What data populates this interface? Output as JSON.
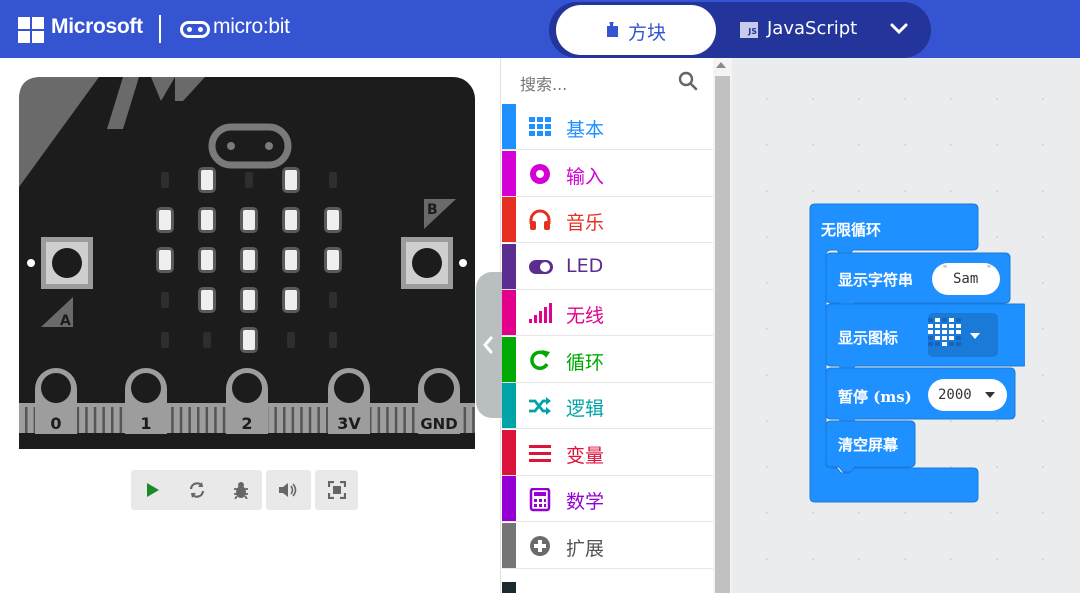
{
  "header": {
    "brand": "Microsoft",
    "product": "micro:bit",
    "tabs": [
      {
        "label": "方块",
        "icon": "puzzle-icon",
        "active": true
      },
      {
        "label": "JavaScript",
        "icon": "js-icon",
        "active": false
      }
    ],
    "colors": {
      "header_bg": "#3454d1",
      "toggle_bg": "#23349a"
    }
  },
  "simulator": {
    "button_a": "A",
    "button_b": "B",
    "pins": [
      "0",
      "1",
      "2",
      "3V",
      "GND"
    ],
    "led_matrix": [
      [
        0,
        1,
        0,
        1,
        0
      ],
      [
        1,
        1,
        1,
        1,
        1
      ],
      [
        1,
        1,
        1,
        1,
        1
      ],
      [
        0,
        1,
        1,
        1,
        0
      ],
      [
        0,
        0,
        1,
        0,
        0
      ]
    ],
    "controls": [
      {
        "icon": "play-icon"
      },
      {
        "icon": "restart-icon"
      },
      {
        "icon": "debug-icon"
      },
      {
        "icon": "mute-icon"
      },
      {
        "icon": "fullscreen-icon"
      }
    ]
  },
  "toolbox": {
    "search_placeholder": "搜索...",
    "categories": [
      {
        "label": "基本",
        "color": "#1e90ff",
        "icon": "grid-icon"
      },
      {
        "label": "输入",
        "color": "#d400d4",
        "icon": "input-circle-icon"
      },
      {
        "label": "音乐",
        "color": "#e63022",
        "icon": "headphones-icon"
      },
      {
        "label": "LED",
        "color": "#5c2d91",
        "icon": "toggle-icon"
      },
      {
        "label": "无线",
        "color": "#e3008c",
        "icon": "signal-bars-icon"
      },
      {
        "label": "循环",
        "color": "#00aa00",
        "icon": "loop-arrow-icon"
      },
      {
        "label": "逻辑",
        "color": "#00a4a6",
        "icon": "shuffle-icon"
      },
      {
        "label": "变量",
        "color": "#dc143c",
        "icon": "list-lines-icon"
      },
      {
        "label": "数学",
        "color": "#9400d3",
        "icon": "calculator-icon"
      },
      {
        "label": "扩展",
        "color": "#757575",
        "icon": "plus-circle-icon"
      }
    ]
  },
  "workspace": {
    "block_color": "#1e90ff",
    "forever": {
      "label": "无限循环"
    },
    "statements": [
      {
        "label": "显示字符串",
        "value": "Sam"
      },
      {
        "label": "显示图标",
        "value_icon": "heart-icon"
      },
      {
        "label": "暂停 (ms)",
        "value": "2000"
      },
      {
        "label": "清空屏幕"
      }
    ]
  }
}
